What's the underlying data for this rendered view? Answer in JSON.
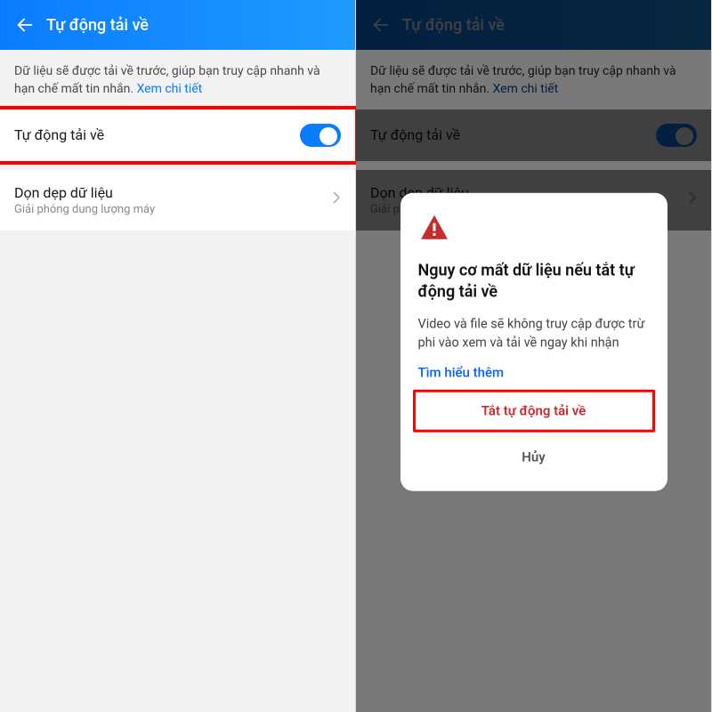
{
  "header": {
    "title": "Tự động tải về"
  },
  "description": {
    "text": "Dữ liệu sẽ được tải về trước, giúp bạn truy cập nhanh và hạn chế mất tin nhắn.",
    "link": "Xem chi tiết"
  },
  "auto_download": {
    "label": "Tự động tải về",
    "enabled": true
  },
  "cleanup": {
    "title": "Dọn dẹp dữ liệu",
    "subtitle": "Giải phóng dung lượng máy"
  },
  "dialog": {
    "title": "Nguy cơ mất dữ liệu nếu tắt tự động tải về",
    "body": "Video và file sẽ không truy cập được trừ phi vào xem và tải về ngay khi nhận",
    "learn_more": "Tìm hiểu thêm",
    "primary_action": "Tắt tự động tải về",
    "cancel_action": "Hủy"
  },
  "cleanup_truncated": {
    "title": "Dọn dẹp dữ liệu",
    "subtitle_prefix": "Giải ph"
  }
}
